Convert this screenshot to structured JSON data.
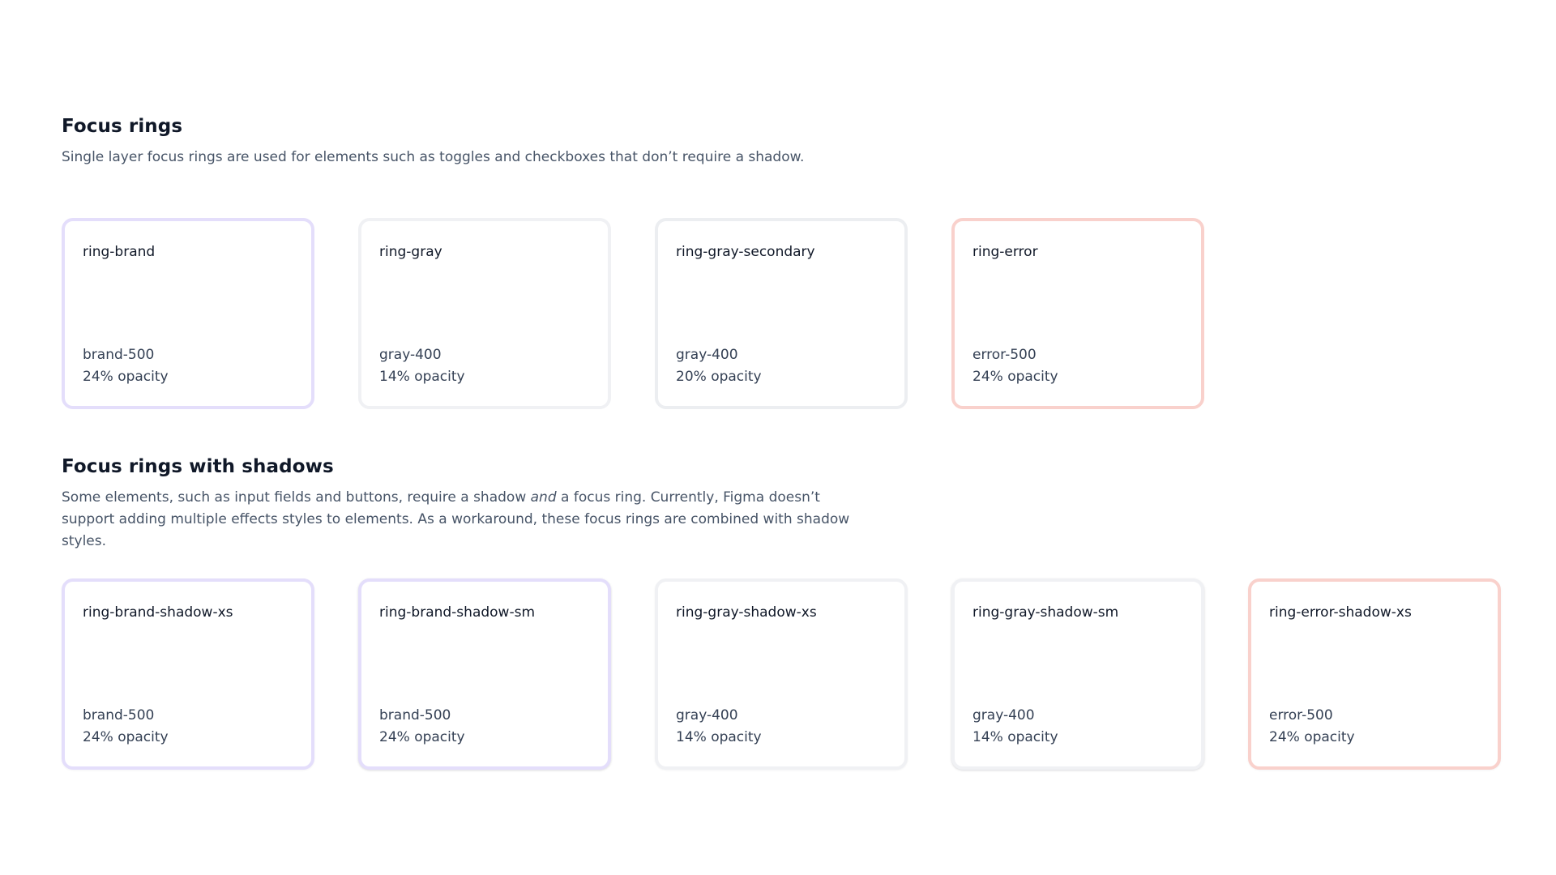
{
  "sections": [
    {
      "title": "Focus rings",
      "description": "Single layer focus rings are used for elements such as toggles and checkboxes that don’t require a shadow.",
      "cards": [
        {
          "name": "ring-brand",
          "color": "brand-500",
          "opacity": "24% opacity",
          "ring_color": "#e4defb"
        },
        {
          "name": "ring-gray",
          "color": "gray-400",
          "opacity": "14% opacity",
          "ring_color": "#f0f1f4"
        },
        {
          "name": "ring-gray-secondary",
          "color": "gray-400",
          "opacity": "20% opacity",
          "ring_color": "#eceef1"
        },
        {
          "name": "ring-error",
          "color": "error-500",
          "opacity": "24% opacity",
          "ring_color": "#f9d1cc"
        }
      ]
    },
    {
      "title": "Focus rings with shadows",
      "description_before": "Some elements, such as input fields and buttons, require a shadow ",
      "description_emphasis": "and",
      "description_after": " a focus ring. Currently, Figma doesn’t support adding multiple effects styles to elements. As a workaround, these focus rings are combined with shadow styles.",
      "cards": [
        {
          "name": "ring-brand-shadow-xs",
          "color": "brand-500",
          "opacity": "24% opacity",
          "ring_color": "#e4defb"
        },
        {
          "name": "ring-brand-shadow-sm",
          "color": "brand-500",
          "opacity": "24% opacity",
          "ring_color": "#e4defb"
        },
        {
          "name": "ring-gray-shadow-xs",
          "color": "gray-400",
          "opacity": "14% opacity",
          "ring_color": "#f0f1f4"
        },
        {
          "name": "ring-gray-shadow-sm",
          "color": "gray-400",
          "opacity": "14% opacity",
          "ring_color": "#f0f1f4"
        },
        {
          "name": "ring-error-shadow-xs",
          "color": "error-500",
          "opacity": "24% opacity",
          "ring_color": "#f9d1cc"
        }
      ]
    }
  ]
}
